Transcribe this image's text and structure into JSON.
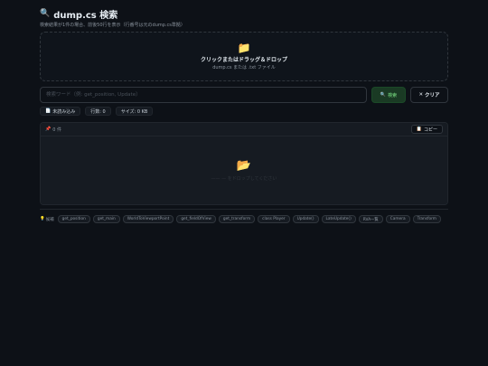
{
  "header": {
    "title": "dump.cs 検索",
    "subtitle": "検索結果が1件の場合、前後50行を表示（行番号は元のdump.cs準拠）"
  },
  "dropzone": {
    "title": "クリックまたはドラッグ＆ドロップ",
    "subtitle": "dump.cs または .txt ファイル"
  },
  "search": {
    "placeholder": "検索ワード（例: get_position, Update）",
    "value": "",
    "search_label": "検索",
    "clear_label": "クリア"
  },
  "stats": [
    {
      "label": "未読み込み"
    },
    {
      "label": "行数: 0"
    },
    {
      "label": "サイズ: 0 KB"
    }
  ],
  "results": {
    "count": "0 件",
    "copy_label": "コピー",
    "empty_message": "—— — をドロップしてください"
  },
  "hints": {
    "label": "候補",
    "chips": [
      "get_position",
      "get_main",
      "WorldToViewportPoint",
      "get_fieldOfView",
      "get_transform",
      "class Player",
      "Update()",
      "LateUpdate()",
      "RVA一覧",
      "Camera",
      "Transform"
    ]
  },
  "colors": {
    "background": "#0d1117",
    "accent_green": "#7ee787",
    "folder_yellow": "#e3b341"
  }
}
